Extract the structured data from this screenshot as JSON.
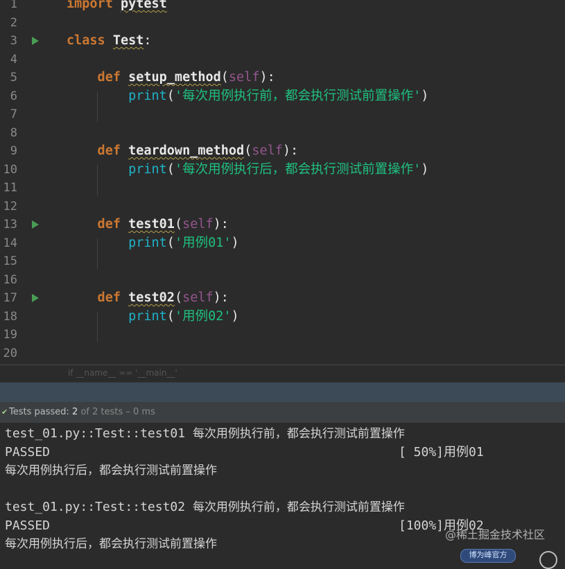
{
  "editor": {
    "lines": [
      {
        "n": "1",
        "parts": [
          {
            "c": "kw",
            "t": "import"
          },
          {
            "c": "punc",
            "t": " "
          },
          {
            "c": "name",
            "t": "pytest"
          }
        ]
      },
      {
        "n": "2",
        "parts": []
      },
      {
        "n": "3",
        "parts": [
          {
            "c": "kw",
            "t": "class"
          },
          {
            "c": "punc",
            "t": " "
          },
          {
            "c": "name",
            "t": "Test"
          },
          {
            "c": "punc",
            "t": ":"
          }
        ]
      },
      {
        "n": "4",
        "parts": []
      },
      {
        "n": "5",
        "parts": [
          {
            "c": "kw",
            "t": "    def"
          },
          {
            "c": "punc",
            "t": " "
          },
          {
            "c": "fn",
            "t": "setup_method"
          },
          {
            "c": "punc",
            "t": "("
          },
          {
            "c": "self",
            "t": "self"
          },
          {
            "c": "punc",
            "t": "):"
          }
        ]
      },
      {
        "n": "6",
        "parts": [
          {
            "c": "builtin",
            "t": "        print"
          },
          {
            "c": "punc",
            "t": "("
          },
          {
            "c": "str",
            "t": "'每次用例执行前，都会执行测试前置操作'"
          },
          {
            "c": "punc",
            "t": ")"
          }
        ]
      },
      {
        "n": "7",
        "parts": []
      },
      {
        "n": "8",
        "parts": []
      },
      {
        "n": "9",
        "parts": [
          {
            "c": "kw",
            "t": "    def"
          },
          {
            "c": "punc",
            "t": " "
          },
          {
            "c": "fn",
            "t": "teardown_method"
          },
          {
            "c": "punc",
            "t": "("
          },
          {
            "c": "self",
            "t": "self"
          },
          {
            "c": "punc",
            "t": "):"
          }
        ]
      },
      {
        "n": "10",
        "parts": [
          {
            "c": "builtin",
            "t": "        print"
          },
          {
            "c": "punc",
            "t": "("
          },
          {
            "c": "str",
            "t": "'每次用例执行后，都会执行测试前置操作'"
          },
          {
            "c": "punc",
            "t": ")"
          }
        ]
      },
      {
        "n": "11",
        "parts": []
      },
      {
        "n": "12",
        "parts": []
      },
      {
        "n": "13",
        "parts": [
          {
            "c": "kw",
            "t": "    def"
          },
          {
            "c": "punc",
            "t": " "
          },
          {
            "c": "fn",
            "t": "test01"
          },
          {
            "c": "punc",
            "t": "("
          },
          {
            "c": "self",
            "t": "self"
          },
          {
            "c": "punc",
            "t": "):"
          }
        ]
      },
      {
        "n": "14",
        "parts": [
          {
            "c": "builtin",
            "t": "        print"
          },
          {
            "c": "punc",
            "t": "("
          },
          {
            "c": "str",
            "t": "'用例01'"
          },
          {
            "c": "punc",
            "t": ")"
          }
        ]
      },
      {
        "n": "15",
        "parts": []
      },
      {
        "n": "16",
        "parts": []
      },
      {
        "n": "17",
        "parts": [
          {
            "c": "kw",
            "t": "    def"
          },
          {
            "c": "punc",
            "t": " "
          },
          {
            "c": "fn",
            "t": "test02"
          },
          {
            "c": "punc",
            "t": "("
          },
          {
            "c": "self",
            "t": "self"
          },
          {
            "c": "punc",
            "t": "):"
          }
        ]
      },
      {
        "n": "18",
        "parts": [
          {
            "c": "builtin",
            "t": "        print"
          },
          {
            "c": "punc",
            "t": "("
          },
          {
            "c": "str",
            "t": "'用例02'"
          },
          {
            "c": "punc",
            "t": ")"
          }
        ]
      },
      {
        "n": "19",
        "parts": []
      },
      {
        "n": "20",
        "parts": []
      }
    ],
    "run_gutter_lines": [
      "3",
      "13",
      "17"
    ]
  },
  "breadcrumb": {
    "text": "if __name__ == '__main__'"
  },
  "status": {
    "label": "Tests passed: ",
    "count": "2",
    "rest": " of 2 tests – 0 ms"
  },
  "console": {
    "lines": [
      {
        "left": "test_01.py::Test::test01 ",
        "cjk": "每次用例执行前，都会执行测试前置操作",
        "right": ""
      },
      {
        "left": "PASSED",
        "cjk": "",
        "right": "[ 50%]用例01"
      },
      {
        "left": "",
        "cjk": "每次用例执行后，都会执行测试前置操作",
        "right": ""
      },
      {
        "left": "",
        "cjk": "",
        "right": ""
      },
      {
        "left": "test_01.py::Test::test02 ",
        "cjk": "每次用例执行前，都会执行测试前置操作",
        "right": ""
      },
      {
        "left": "PASSED",
        "cjk": "",
        "right": "[100%]用例02"
      },
      {
        "left": "",
        "cjk": "每次用例执行后，都会执行测试前置操作",
        "right": ""
      }
    ]
  },
  "watermark": {
    "text": "@稀土掘金技术社区"
  },
  "widget": {
    "label": "博为峰官方"
  },
  "colors": {
    "keyword": "#cc7832",
    "self": "#94558d",
    "string": "#1fc080",
    "builtin": "#20b3c8",
    "run_arrow": "#499c54"
  }
}
